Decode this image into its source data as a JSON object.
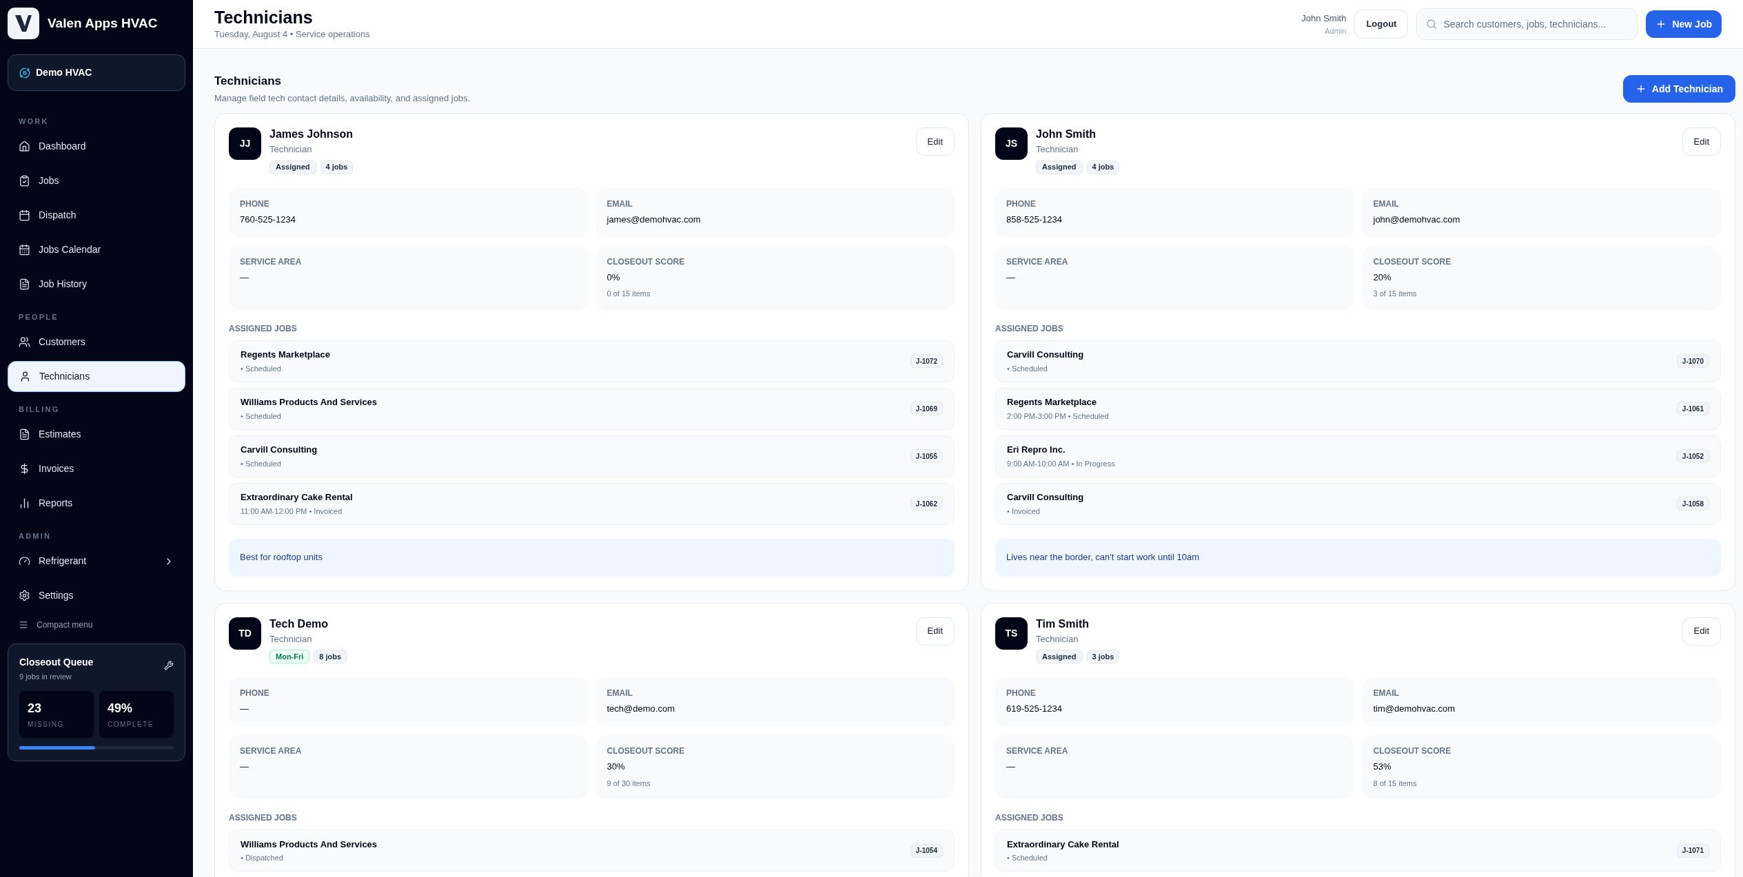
{
  "brand": {
    "name": "Valen Apps HVAC"
  },
  "workspace": {
    "name": "Demo HVAC"
  },
  "sidebar": {
    "sections": [
      {
        "label": "WORK",
        "items": [
          {
            "label": "Dashboard",
            "selected": false,
            "has_submenu": false
          },
          {
            "label": "Jobs",
            "selected": false,
            "has_submenu": false
          },
          {
            "label": "Dispatch",
            "selected": false,
            "has_submenu": false
          },
          {
            "label": "Jobs Calendar",
            "selected": false,
            "has_submenu": false
          },
          {
            "label": "Job History",
            "selected": false,
            "has_submenu": false
          }
        ]
      },
      {
        "label": "PEOPLE",
        "items": [
          {
            "label": "Customers",
            "selected": false,
            "has_submenu": false
          },
          {
            "label": "Technicians",
            "selected": true,
            "has_submenu": false
          }
        ]
      },
      {
        "label": "BILLING",
        "items": [
          {
            "label": "Estimates",
            "selected": false,
            "has_submenu": false
          },
          {
            "label": "Invoices",
            "selected": false,
            "has_submenu": false
          },
          {
            "label": "Reports",
            "selected": false,
            "has_submenu": false
          }
        ]
      },
      {
        "label": "ADMIN",
        "items": [
          {
            "label": "Refrigerant",
            "selected": false,
            "has_submenu": true
          },
          {
            "label": "Settings",
            "selected": false,
            "has_submenu": false
          }
        ]
      }
    ],
    "compact_toggle": "Compact menu"
  },
  "closeout_queue": {
    "title": "Closeout Queue",
    "subtitle": "9 jobs in review",
    "stats": [
      {
        "value": "23",
        "label": "MISSING"
      },
      {
        "value": "49%",
        "label": "COMPLETE"
      }
    ],
    "level": 0.49
  },
  "header": {
    "title": "Technicians",
    "subtitle": "Tuesday, August 4 • Service operations",
    "user": {
      "name": "John Smith",
      "role": "Admin"
    },
    "logout": "Logout",
    "search": {
      "placeholder": "Search customers, jobs, technicians..."
    },
    "new_job": "New Job"
  },
  "section": {
    "title": "Technicians",
    "description": "Manage field tech contact details, availability, and assigned jobs.",
    "add_button": "Add Technician"
  },
  "technicians": [
    {
      "initials": "JJ",
      "name": "James Johnson",
      "role": "Technician",
      "status": {
        "label": "Assigned",
        "kind": "assigned"
      },
      "job_count": "4 jobs",
      "edit": "Edit",
      "fields": [
        {
          "label": "PHONE",
          "value": "760-525-1234"
        },
        {
          "label": "EMAIL",
          "value": "james@demohvac.com"
        },
        {
          "label": "SERVICE AREA",
          "value": "—"
        },
        {
          "label": "CLOSEOUT SCORE",
          "value": "0%",
          "detail": "0 of 15 items"
        }
      ],
      "jobs_label": "ASSIGNED JOBS",
      "jobs": [
        {
          "customer": "Regents Marketplace",
          "meta": "• Scheduled",
          "id": "J-1072"
        },
        {
          "customer": "Williams Products And Services",
          "meta": "• Scheduled",
          "id": "J-1069"
        },
        {
          "customer": "Carvill Consulting",
          "meta": "• Scheduled",
          "id": "J-1055"
        },
        {
          "customer": "Extraordinary Cake Rental",
          "meta": "11:00 AM-12:00 PM • Invoiced",
          "id": "J-1062"
        }
      ],
      "note": "Best for rooftop units"
    },
    {
      "initials": "JS",
      "name": "John Smith",
      "role": "Technician",
      "status": {
        "label": "Assigned",
        "kind": "assigned"
      },
      "job_count": "4 jobs",
      "edit": "Edit",
      "fields": [
        {
          "label": "PHONE",
          "value": "858-525-1234"
        },
        {
          "label": "EMAIL",
          "value": "john@demohvac.com"
        },
        {
          "label": "SERVICE AREA",
          "value": "—"
        },
        {
          "label": "CLOSEOUT SCORE",
          "value": "20%",
          "detail": "3 of 15 items"
        }
      ],
      "jobs_label": "ASSIGNED JOBS",
      "jobs": [
        {
          "customer": "Carvill Consulting",
          "meta": "• Scheduled",
          "id": "J-1070"
        },
        {
          "customer": "Regents Marketplace",
          "meta": "2:00 PM-3:00 PM • Scheduled",
          "id": "J-1061"
        },
        {
          "customer": "Eri Repro Inc.",
          "meta": "9:00 AM-10:00 AM • In Progress",
          "id": "J-1052"
        },
        {
          "customer": "Carvill Consulting",
          "meta": "• Invoiced",
          "id": "J-1058"
        }
      ],
      "note": "Lives near the border, can't start work until 10am"
    },
    {
      "initials": "TD",
      "name": "Tech Demo",
      "role": "Technician",
      "status": {
        "label": "Mon-Fri",
        "kind": "available"
      },
      "job_count": "8 jobs",
      "edit": "Edit",
      "fields": [
        {
          "label": "PHONE",
          "value": "—"
        },
        {
          "label": "EMAIL",
          "value": "tech@demo.com"
        },
        {
          "label": "SERVICE AREA",
          "value": "—"
        },
        {
          "label": "CLOSEOUT SCORE",
          "value": "30%",
          "detail": "9 of 30 items"
        }
      ],
      "jobs_label": "ASSIGNED JOBS",
      "jobs": [
        {
          "customer": "Williams Products And Services",
          "meta": "• Dispatched",
          "id": "J-1054"
        }
      ]
    },
    {
      "initials": "TS",
      "name": "Tim Smith",
      "role": "Technician",
      "status": {
        "label": "Assigned",
        "kind": "assigned"
      },
      "job_count": "3 jobs",
      "edit": "Edit",
      "fields": [
        {
          "label": "PHONE",
          "value": "619-525-1234"
        },
        {
          "label": "EMAIL",
          "value": "tim@demohvac.com"
        },
        {
          "label": "SERVICE AREA",
          "value": "—"
        },
        {
          "label": "CLOSEOUT SCORE",
          "value": "53%",
          "detail": "8 of 15 items"
        }
      ],
      "jobs_label": "ASSIGNED JOBS",
      "jobs": [
        {
          "customer": "Extraordinary Cake Rental",
          "meta": "• Scheduled",
          "id": "J-1071"
        }
      ]
    }
  ]
}
